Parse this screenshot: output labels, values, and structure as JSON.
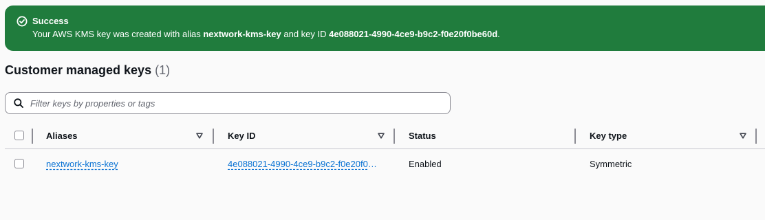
{
  "flash": {
    "title": "Success",
    "message_prefix": "Your AWS KMS key was created with alias ",
    "alias": "nextwork-kms-key",
    "message_middle": " and key ID ",
    "key_id": "4e088021-4990-4ce9-b9c2-f0e20f0be60d",
    "message_suffix": ".",
    "icon": "check-circle-icon",
    "color": "#207c3d"
  },
  "section": {
    "title": "Customer managed keys",
    "count": "(1)"
  },
  "search": {
    "placeholder": "Filter keys by properties or tags",
    "value": "",
    "icon": "search-icon"
  },
  "table": {
    "columns": [
      {
        "label": "Aliases",
        "sortable": true
      },
      {
        "label": "Key ID",
        "sortable": true
      },
      {
        "label": "Status",
        "sortable": false
      },
      {
        "label": "Key type",
        "sortable": true
      }
    ],
    "rows": [
      {
        "alias": "nextwork-kms-key",
        "key_id": "4e088021-4990-4ce9-b9c2-f0e20f0be60d",
        "status": "Enabled",
        "key_type": "Symmetric"
      }
    ]
  },
  "colors": {
    "link": "#0972d3",
    "text": "#0f141a",
    "muted": "#656871"
  }
}
